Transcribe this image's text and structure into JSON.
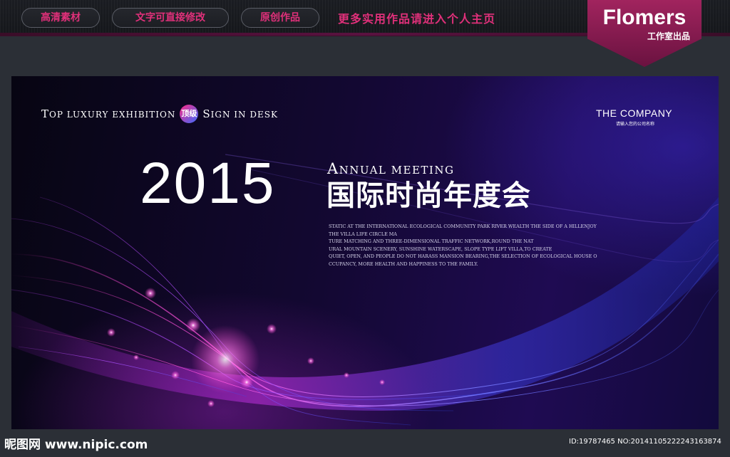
{
  "topbar": {
    "buttons": [
      {
        "label": "高清素材"
      },
      {
        "label": "文字可直接修改"
      },
      {
        "label": "原创作品"
      }
    ],
    "promo": "更多实用作品请进入个人主页"
  },
  "badge": {
    "title": "Flomers",
    "subtitle": "工作室出品"
  },
  "banner": {
    "tagline_part1_first": "T",
    "tagline_part1_rest": "OP LUXURY EXHIBITION",
    "tagline_badge": "顶级",
    "tagline_part2_first": "S",
    "tagline_part2_rest": "IGN IN DESK",
    "company": "THE COMPANY",
    "company_sub": "请输入您的公司名称",
    "year": "2015",
    "annual_first": "A",
    "annual_rest": "NNUAL MEETING",
    "title_cn": "国际时尚年度会",
    "paragraph": [
      "STATIC AT THE INTERNATIONAL ECOLOGICAL COMMUNITY PARK RIVER WEALTH THE SIDE OF A HILLENJOY",
      "THE VILLA LIFE CIRCLE MA",
      "TURE MATCHING AND THREE-DIMENSIONAL TRAFFIC NETWORK,ROUND THE NAT",
      "URAL MOUNTAIN SCENERY, SUNSHINE WATERSCAPE, SLOPE TYPE LIFT VILLA,TO CREATE",
      "QUIET, OPEN, AND PEOPLE DO NOT HARASS MANSION BEARING,THE SELECTION OF ECOLOGICAL HOUSE O",
      "CCUPANCY, MORE HEALTH AND HAPPINESS TO THE FAMILY."
    ]
  },
  "watermark": {
    "site": "昵图网 www.nipic.com",
    "id": "ID:19787465 NO:20141105222243163874"
  },
  "colors": {
    "accent": "#e0307a",
    "badge": "#8a1a50",
    "banner_dark": "#0a0620"
  }
}
